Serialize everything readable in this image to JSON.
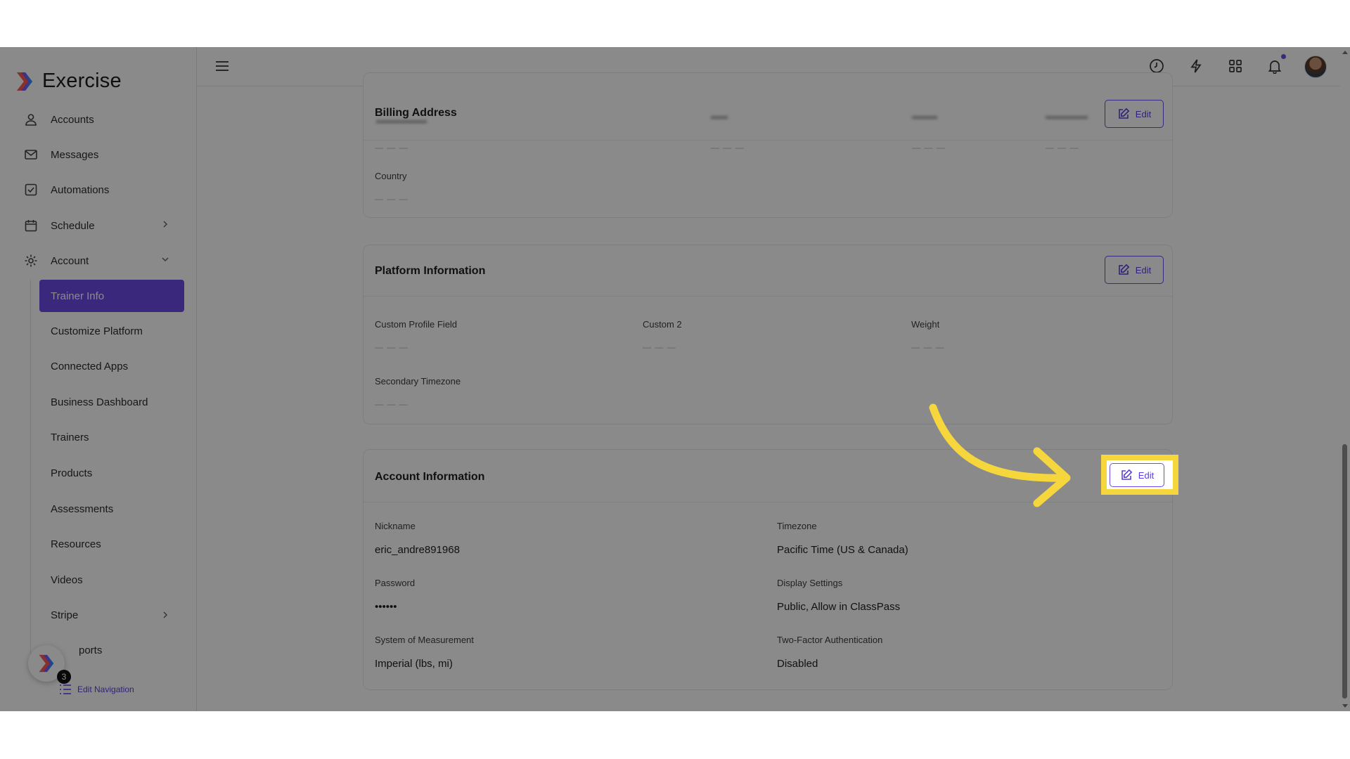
{
  "app": {
    "name": "Exercise"
  },
  "sidebar": {
    "items": [
      {
        "label": "Accounts",
        "icon": "user-icon"
      },
      {
        "label": "Messages",
        "icon": "mail-icon"
      },
      {
        "label": "Automations",
        "icon": "checkbox-icon"
      },
      {
        "label": "Schedule",
        "icon": "calendar-icon"
      },
      {
        "label": "Account",
        "icon": "gear-icon"
      }
    ],
    "sub_items": [
      {
        "label": "Trainer Info",
        "active": true
      },
      {
        "label": "Customize Platform"
      },
      {
        "label": "Connected Apps"
      },
      {
        "label": "Business Dashboard"
      },
      {
        "label": "Trainers"
      },
      {
        "label": "Products"
      },
      {
        "label": "Assessments"
      },
      {
        "label": "Resources"
      },
      {
        "label": "Videos"
      },
      {
        "label": "Stripe"
      },
      {
        "label": "ports"
      }
    ],
    "fab_badge": "3",
    "edit_navigation": "Edit Navigation"
  },
  "topbar": {
    "icons": [
      "menu-icon",
      "clock-icon",
      "lightning-icon",
      "grid-icon",
      "bell-icon",
      "avatar"
    ]
  },
  "billing": {
    "title": "Billing Address",
    "edit_label": "Edit",
    "country_label": "Country",
    "empty": "— — —"
  },
  "platform": {
    "title": "Platform Information",
    "edit_label": "Edit",
    "fields": [
      {
        "label": "Custom Profile Field",
        "value": "— — —"
      },
      {
        "label": "Custom 2",
        "value": "— — —"
      },
      {
        "label": "Weight",
        "value": "— — —"
      },
      {
        "label": "Secondary Timezone",
        "value": "— — —"
      }
    ]
  },
  "account_info": {
    "title": "Account Information",
    "edit_label": "Edit",
    "fields": [
      {
        "label": "Nickname",
        "value": "eric_andre891968"
      },
      {
        "label": "Timezone",
        "value": "Pacific Time (US & Canada)"
      },
      {
        "label": "Password",
        "value": "••••••"
      },
      {
        "label": "Display Settings",
        "value": "Public, Allow in ClassPass"
      },
      {
        "label": "System of Measurement",
        "value": "Imperial (lbs, mi)"
      },
      {
        "label": "Two-Factor Authentication",
        "value": "Disabled"
      }
    ]
  },
  "colors": {
    "accent": "#6a4be3",
    "highlight": "#f5d63d"
  }
}
